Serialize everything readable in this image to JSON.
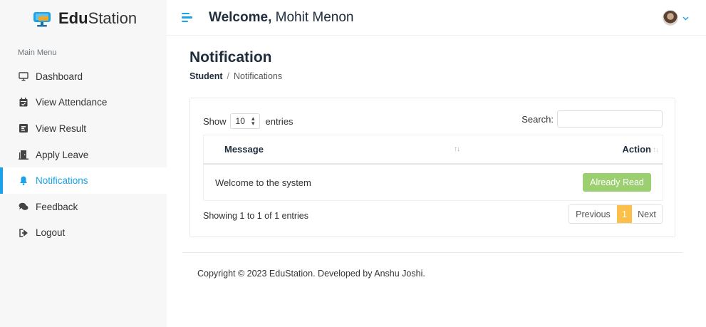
{
  "brand": {
    "name_bold": "Edu",
    "name_rest": "Station"
  },
  "sidebar": {
    "section_title": "Main Menu",
    "items": [
      {
        "label": "Dashboard",
        "icon": "monitor-icon",
        "active": false
      },
      {
        "label": "View Attendance",
        "icon": "calendar-icon",
        "active": false
      },
      {
        "label": "View Result",
        "icon": "poll-icon",
        "active": false
      },
      {
        "label": "Apply Leave",
        "icon": "door-icon",
        "active": false
      },
      {
        "label": "Notifications",
        "icon": "bell-icon",
        "active": true
      },
      {
        "label": "Feedback",
        "icon": "comments-icon",
        "active": false
      },
      {
        "label": "Logout",
        "icon": "sign-out-icon",
        "active": false
      }
    ]
  },
  "header": {
    "welcome_bold": "Welcome,",
    "user_name": "Mohit Menon"
  },
  "page": {
    "title": "Notification",
    "breadcrumb": {
      "root": "Student",
      "separator": "/",
      "current": "Notifications"
    }
  },
  "table_controls": {
    "show_label": "Show",
    "entries_value": "10",
    "entries_label": "entries",
    "search_label": "Search:",
    "search_value": ""
  },
  "table": {
    "columns": [
      "Message",
      "Action"
    ],
    "rows": [
      {
        "message": "Welcome to the system",
        "action": "Already Read"
      }
    ]
  },
  "pagination": {
    "info": "Showing 1 to 1 of 1 entries",
    "previous": "Previous",
    "current": "1",
    "next": "Next"
  },
  "footer": {
    "text": "Copyright © 2023 EduStation. Developed by Anshu Joshi."
  },
  "colors": {
    "accent": "#1aa3e8",
    "read_button": "#9ccf6f",
    "page_active": "#fbbf4a"
  }
}
